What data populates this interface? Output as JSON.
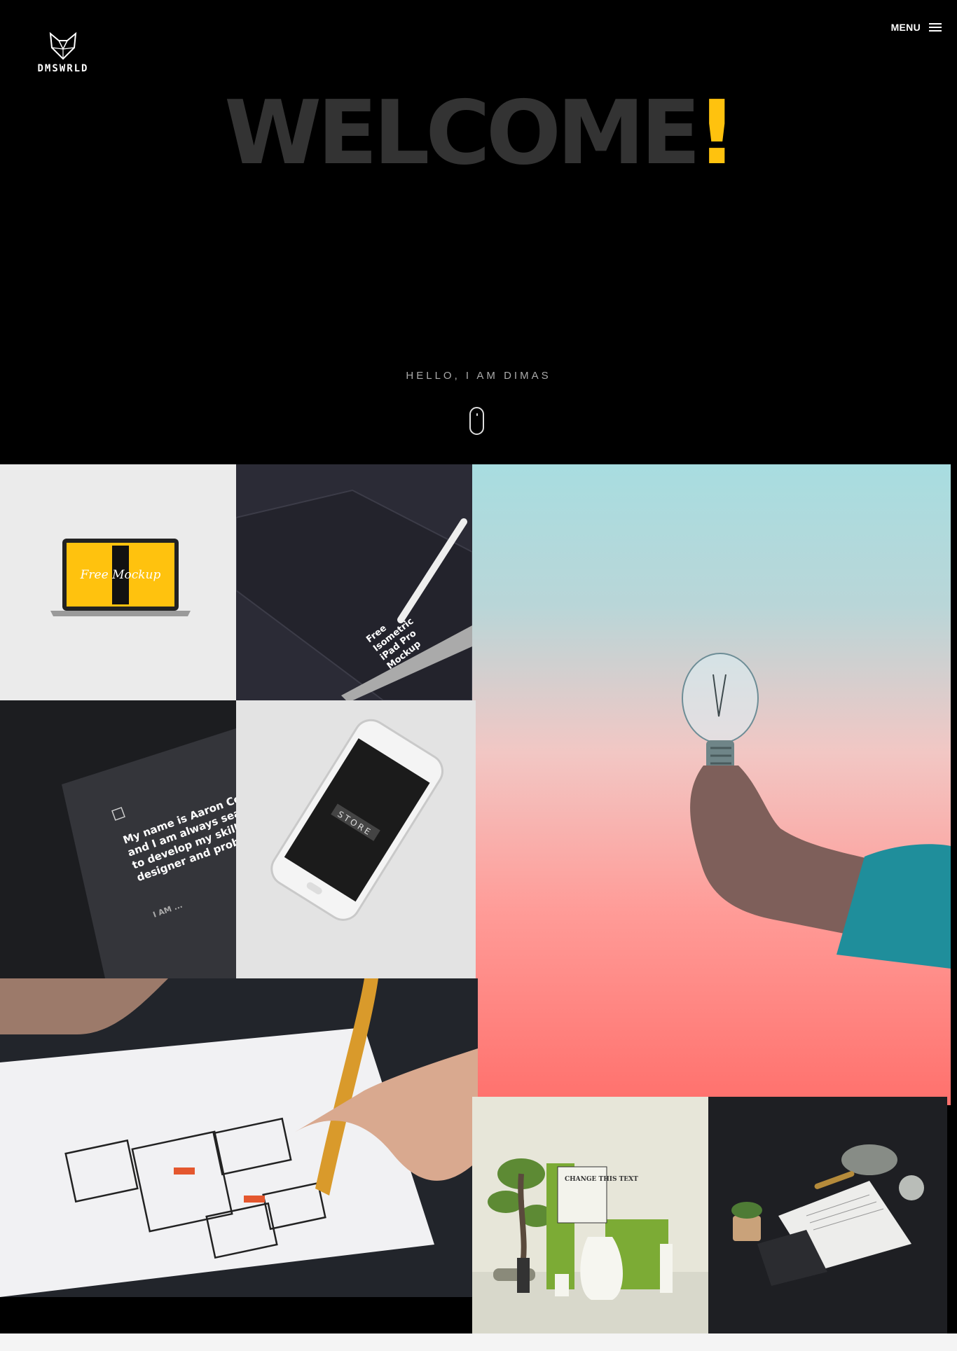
{
  "header": {
    "logo_text": "DMSWRLD",
    "menu_label": "MENU"
  },
  "hero": {
    "title": "WELCOME",
    "title_accent": "!",
    "subtitle": "HELLO, I AM DIMAS"
  },
  "colors": {
    "accent": "#FFC20E",
    "background": "#000000",
    "title_gray": "#333333"
  },
  "portfolio": {
    "laptop_mockup_text": "Free Mockup",
    "ipad_mockup_lines": [
      "Free",
      "Isometric",
      "iPad Pro",
      "Mockup"
    ],
    "card_lines": [
      "My name is Aaron Covre",
      "and I am always search",
      "to develop my skills a",
      "designer and problem"
    ],
    "card_footer": "I AM ...",
    "phone_screen_text": "STORE",
    "stationery_text": "CHANGE THIS TEXT"
  }
}
